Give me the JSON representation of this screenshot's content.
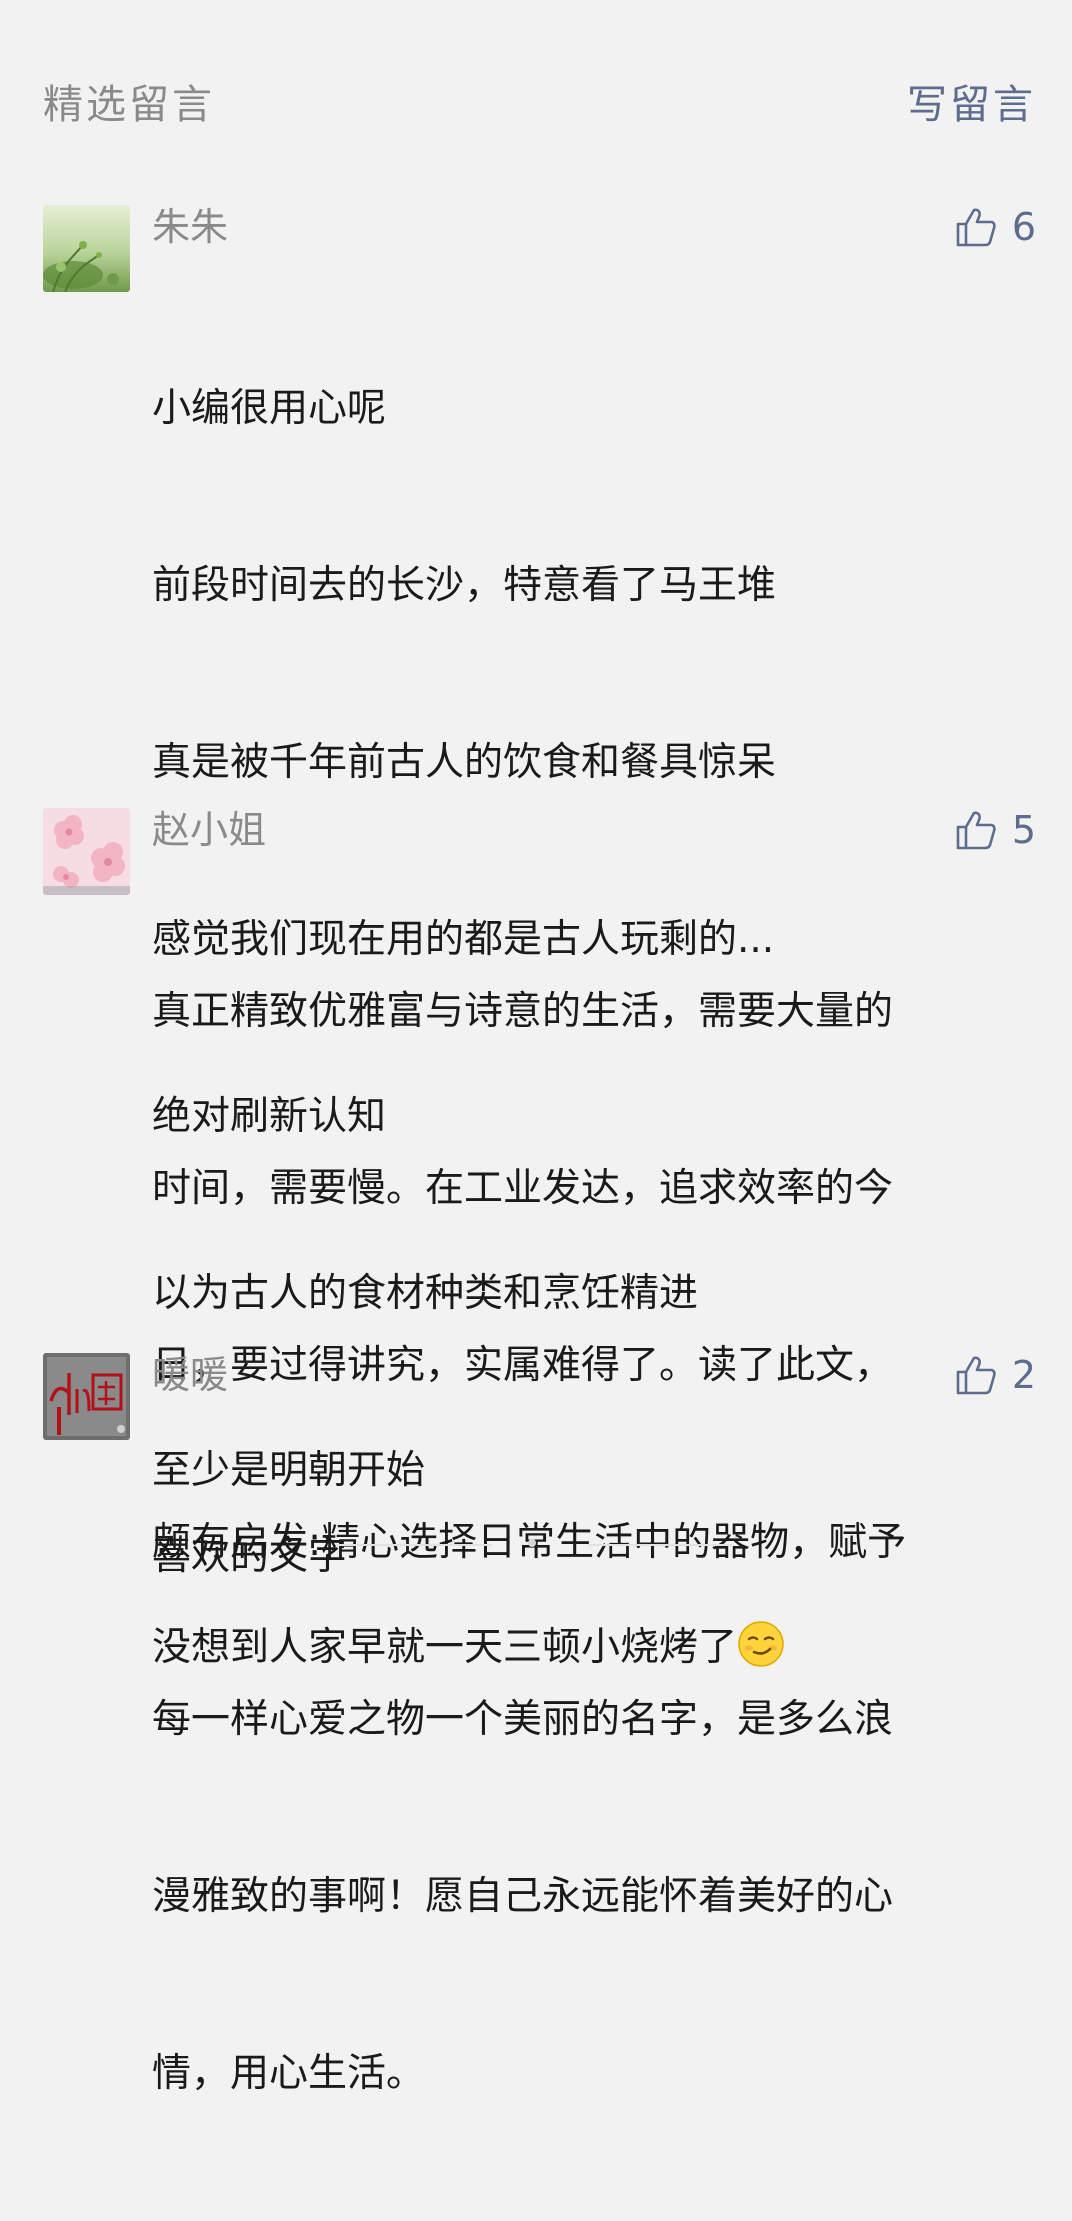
{
  "header": {
    "title": "精选留言",
    "write_label": "写留言"
  },
  "comments": [
    {
      "nickname": "朱朱",
      "likes": "6",
      "avatar_icon": "green-plant-avatar-icon",
      "lines": [
        "小编很用心呢",
        "前段时间去的长沙，特意看了马王堆",
        "真是被千年前古人的饮食和餐具惊呆",
        "感觉我们现在用的都是古人玩剩的...",
        "绝对刷新认知",
        "以为古人的食材种类和烹饪精进",
        "至少是明朝开始",
        "没想到人家早就一天三顿小烧烤了"
      ],
      "trailing_emoji": "smirk-face-emoji"
    },
    {
      "nickname": "赵小姐",
      "likes": "5",
      "avatar_icon": "pink-blossom-avatar-icon",
      "lines": [
        "真正精致优雅富与诗意的生活，需要大量的",
        "时间，需要慢。在工业发达，追求效率的今",
        "日，要过得讲究，实属难得了。读了此文，",
        "颇有启发:精心选择日常生活中的器物，赋予",
        "每一样心爱之物一个美丽的名字，是多么浪",
        "漫雅致的事啊！愿自己永远能怀着美好的心",
        "情，用心生活。"
      ]
    },
    {
      "nickname": "暖暖",
      "likes": "2",
      "avatar_icon": "china-calligraphy-avatar-icon",
      "lines": [
        "喜欢的文字"
      ]
    }
  ],
  "colors": {
    "background": "#f2f2f2",
    "muted_text": "#8a8a8a",
    "link_blue": "#5d6d8e",
    "body_text": "#1a1a1a"
  }
}
